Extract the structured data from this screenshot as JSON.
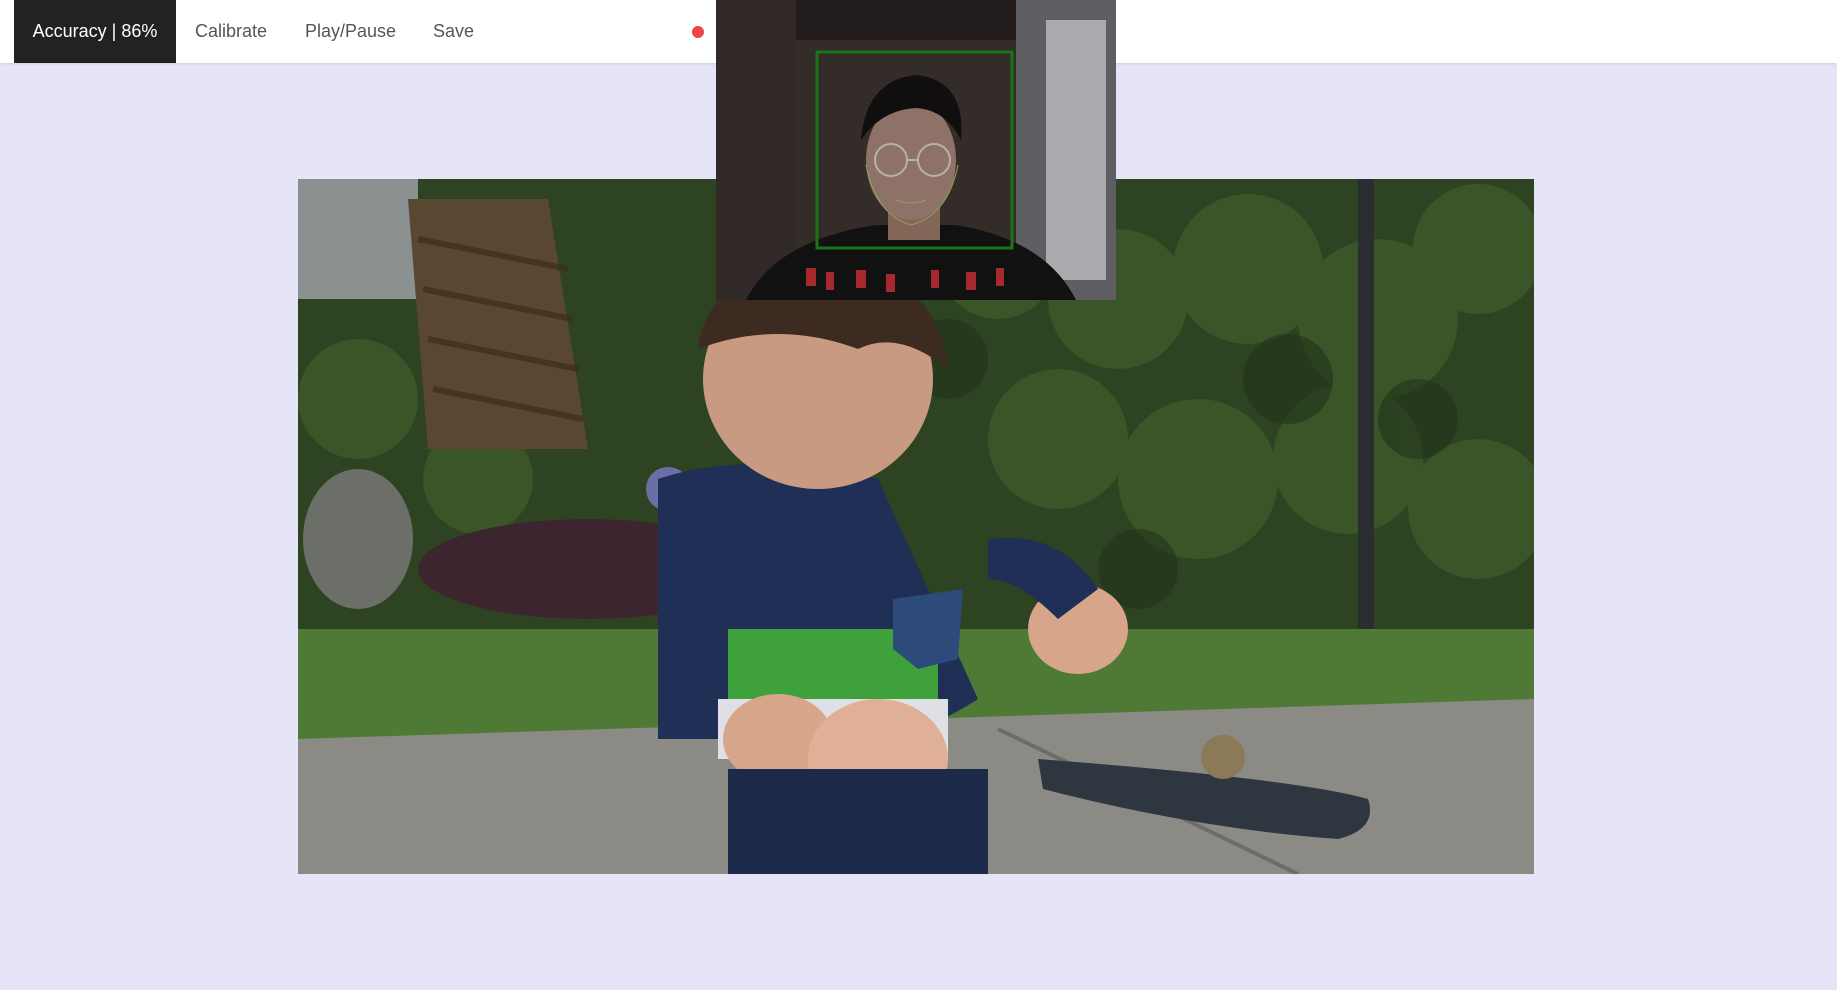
{
  "navbar": {
    "accuracy_label": "Accuracy | 86%",
    "calibrate_label": "Calibrate",
    "playpause_label": "Play/Pause",
    "save_label": "Save",
    "recording_indicator": {
      "icon": "record-dot-icon",
      "color": "#ef4444"
    }
  },
  "colors": {
    "page_background": "#e5e5f7",
    "navbar_background": "#ffffff",
    "active_item_background": "#222222",
    "face_box": "#1f8a1f"
  },
  "video": {
    "content": "video-frame"
  },
  "webcam": {
    "content": "webcam-preview",
    "face_detected": true
  }
}
